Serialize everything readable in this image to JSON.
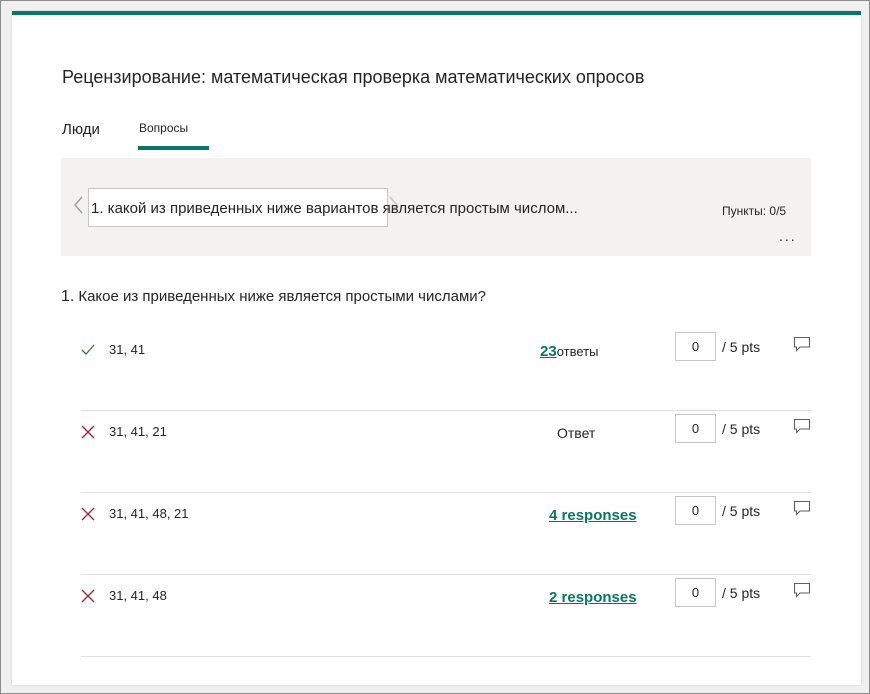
{
  "header": {
    "title": "Рецензирование: математическая проверка математических опросов",
    "accent_color": "#077568"
  },
  "tabs": [
    {
      "label": "Люди",
      "selected": false
    },
    {
      "label": "Вопросы",
      "selected": true
    }
  ],
  "question_nav": {
    "current_question": "1. какой из приведенных ниже вариантов является простым числом...",
    "points": "Пункты: 0/5",
    "more_label": "...",
    "prev_icon": "chevron-left-icon",
    "next_icon": "chevron-right-icon"
  },
  "question": {
    "number": "1.",
    "text": "Какое из приведенных ниже является простыми числами?"
  },
  "answers": [
    {
      "status": "correct",
      "status_icon": "checkmark-icon",
      "text": "31, 41",
      "responses_count": "23",
      "responses_label": "ответы",
      "score": "0",
      "out_of": "/ 5 pts"
    },
    {
      "status": "incorrect",
      "status_icon": "cross-icon",
      "text": "31, 41, 21",
      "responses_label": "Ответ",
      "score": "0",
      "out_of": "/ 5 pts"
    },
    {
      "status": "incorrect",
      "status_icon": "cross-icon",
      "text": "31, 41, 48, 21",
      "responses_label": "4 responses",
      "score": "0",
      "out_of": "/ 5 pts"
    },
    {
      "status": "incorrect",
      "status_icon": "cross-icon",
      "text": "31, 41, 48",
      "responses_label": "2 responses",
      "score": "0",
      "out_of": "/ 5 pts"
    }
  ],
  "colors": {
    "correct": "#2e7d32",
    "incorrect": "#a4262c",
    "link": "#077568"
  }
}
